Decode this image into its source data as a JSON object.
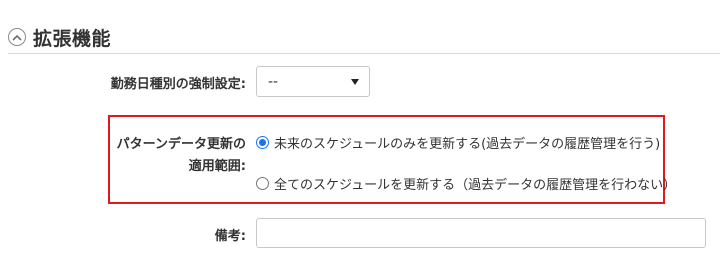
{
  "section": {
    "title": "拡張機能",
    "collapse_icon": "chevron-up-icon"
  },
  "fields": {
    "forced_setting": {
      "label": "勤務日種別の強制設定:",
      "selected_value": "--"
    },
    "pattern_update_scope": {
      "label_line1": "パターンデータ更新の",
      "label_line2": "適用範囲:",
      "options": [
        {
          "label": "未来のスケジュールのみを更新する(過去データの履歴管理を行う)",
          "checked": true
        },
        {
          "label": "全てのスケジュールを更新する（過去データの履歴管理を行わない）",
          "checked": false
        }
      ]
    },
    "remarks": {
      "label": "備考:",
      "value": ""
    }
  },
  "colors": {
    "highlight_border": "#e0191f",
    "radio_accent": "#1a73e8"
  }
}
